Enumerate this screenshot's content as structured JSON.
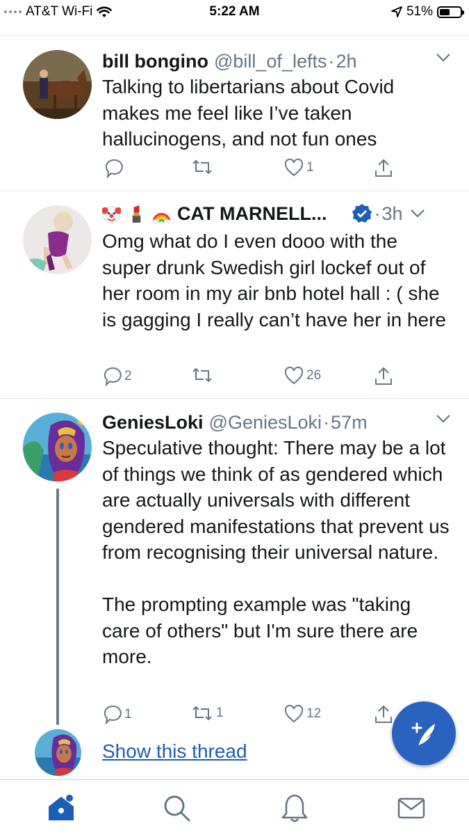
{
  "status_bar": {
    "carrier": "AT&T Wi-Fi",
    "time": "5:22 AM",
    "battery": "51%",
    "battery_level": 0.51
  },
  "tweets": [
    {
      "name": "bill bongino",
      "handle": "@bill_of_lefts",
      "time": "2h",
      "text": "Talking to libertarians about Covid makes me feel like I’ve taken hallucinogens, and not fun ones",
      "replies": "",
      "retweets": "",
      "likes": "1"
    },
    {
      "name_emojis": [
        "clown-face",
        "lipstick",
        "rainbow"
      ],
      "name": "CAT MARNELL...",
      "verified": true,
      "time": "3h",
      "text": "Omg what do I even dooo with the super drunk Swedish girl lockef out of her room in my air bnb hotel hall : ( she is gagging I really can’t have her in here",
      "replies": "2",
      "retweets": "",
      "likes": "26"
    },
    {
      "name": "GeniesLoki",
      "handle": "@GeniesLoki",
      "time": "57m",
      "text": "Speculative thought: There may be a lot of things we think of as gendered which are actually universals with different gendered manifestations that prevent us from recognising their universal nature.\n\nThe prompting example was \"taking care of others\" but I'm sure there are more.",
      "replies": "1",
      "retweets": "1",
      "likes": "12"
    }
  ],
  "thread": {
    "show_label": "Show this thread"
  },
  "tab_bar": {
    "items": [
      "home-icon",
      "search-icon",
      "notifications-icon",
      "messages-icon"
    ],
    "active": "home-icon"
  },
  "colors": {
    "accent": "#1b5fb6",
    "fab": "#2a62c0",
    "muted": "#657786",
    "divider": "#e1e8ed"
  }
}
